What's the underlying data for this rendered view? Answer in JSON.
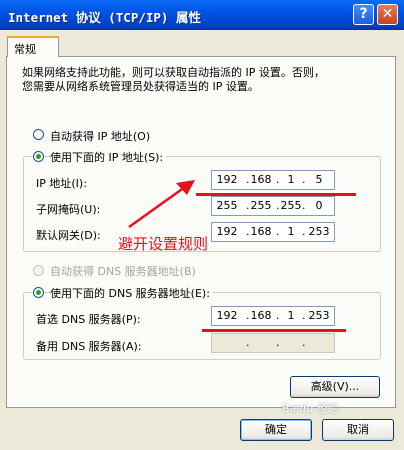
{
  "window": {
    "title": "Internet 协议 (TCP/IP) 属性",
    "help_glyph": "?",
    "close_glyph": "✕"
  },
  "tabs": [
    {
      "label": "常规"
    }
  ],
  "intro_text": "如果网络支持此功能，则可以获取自动指派的 IP 设置。否则，\n您需要从网络系统管理员处获得适当的 IP 设置。",
  "ip": {
    "auto_label": "自动获得 IP 地址(O)",
    "manual_label": "使用下面的 IP 地址(S):",
    "address_label": "IP 地址(I):",
    "mask_label": "子网掩码(U):",
    "gateway_label": "默认网关(D):",
    "address": [
      "192",
      "168",
      "1",
      "5"
    ],
    "mask": [
      "255",
      "255",
      "255",
      "0"
    ],
    "gateway": [
      "192",
      "168",
      "1",
      "253"
    ]
  },
  "dns": {
    "auto_label": "自动获得 DNS 服务器地址(B)",
    "manual_label": "使用下面的 DNS 服务器地址(E):",
    "preferred_label": "首选 DNS 服务器(P):",
    "alternate_label": "备用 DNS 服务器(A):",
    "preferred": [
      "192",
      "168",
      "1",
      "253"
    ],
    "alternate": [
      "",
      "",
      "",
      ""
    ]
  },
  "buttons": {
    "advanced": "高级(V)...",
    "ok": "确定",
    "cancel": "取消"
  },
  "annotation": {
    "text": "避开设置规则",
    "color": "#e8101d"
  },
  "watermark": "Baidu 经验"
}
